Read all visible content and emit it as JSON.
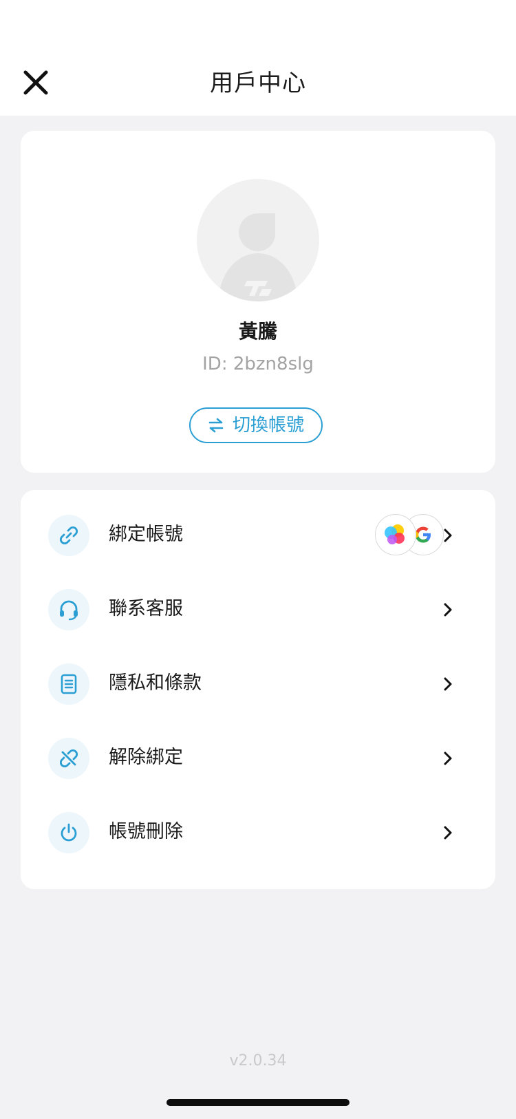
{
  "header": {
    "title": "用戶中心"
  },
  "profile": {
    "name": "黃騰",
    "id_text": "ID: 2bzn8slg",
    "switch_label": "切換帳號"
  },
  "menu": {
    "items": [
      {
        "label": "綁定帳號",
        "icon": "link-icon"
      },
      {
        "label": "聯系客服",
        "icon": "headset-icon"
      },
      {
        "label": "隱私和條款",
        "icon": "document-icon"
      },
      {
        "label": "解除綁定",
        "icon": "unlink-icon"
      },
      {
        "label": "帳號刪除",
        "icon": "power-icon"
      }
    ],
    "bound_accounts": [
      "game-center-icon",
      "google-icon"
    ]
  },
  "version": "v2.0.34",
  "colors": {
    "accent": "#2b9fd4",
    "icon_bg": "#ecf6fb",
    "page_bg": "#f2f2f4"
  }
}
